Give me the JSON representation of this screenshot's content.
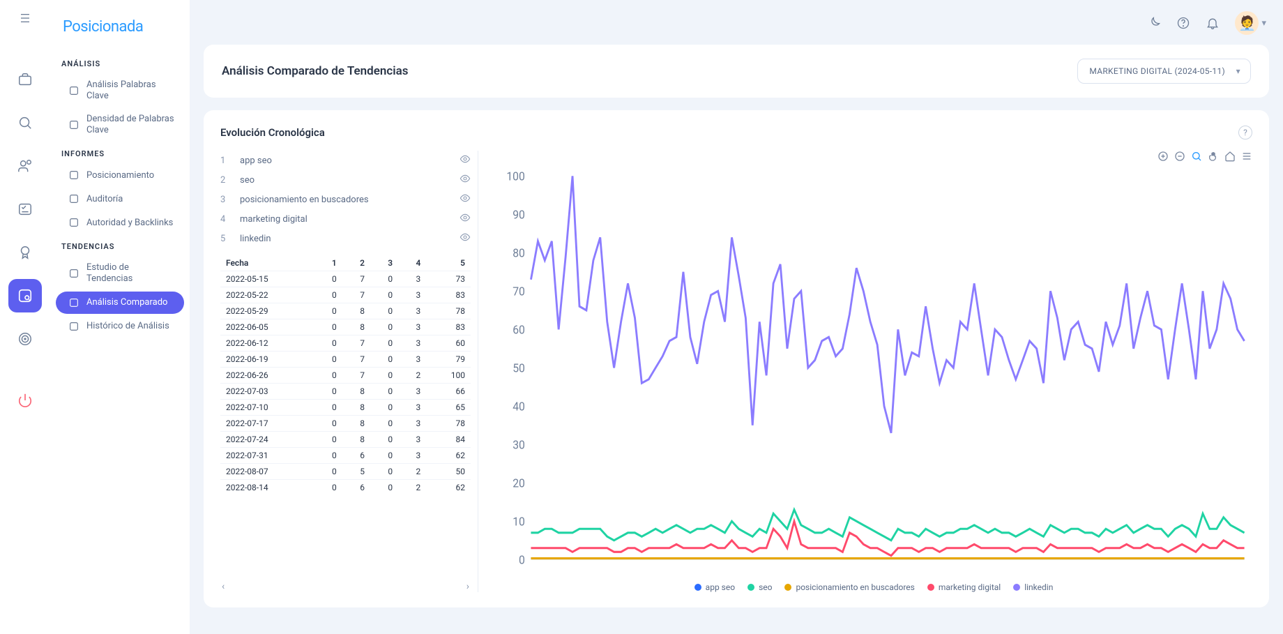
{
  "brand": "Posicionada",
  "sidebar": {
    "sections": [
      {
        "label": "ANÁLISIS",
        "items": [
          {
            "label": "Análisis Palabras Clave",
            "active": false
          },
          {
            "label": "Densidad de Palabras Clave",
            "active": false
          }
        ]
      },
      {
        "label": "INFORMES",
        "items": [
          {
            "label": "Posicionamiento",
            "active": false
          },
          {
            "label": "Auditoría",
            "active": false
          },
          {
            "label": "Autoridad y Backlinks",
            "active": false
          }
        ]
      },
      {
        "label": "TENDENCIAS",
        "items": [
          {
            "label": "Estudio de Tendencias",
            "active": false
          },
          {
            "label": "Análisis Comparado",
            "active": true
          },
          {
            "label": "Histórico de Análisis",
            "active": false
          }
        ]
      }
    ]
  },
  "header": {
    "title": "Análisis Comparado de Tendencias",
    "selected_project": "MARKETING DIGITAL (2024-05-11)"
  },
  "panel_title": "Evolución Cronológica",
  "keywords": [
    {
      "idx": 1,
      "name": "app seo"
    },
    {
      "idx": 2,
      "name": "seo"
    },
    {
      "idx": 3,
      "name": "posicionamiento en buscadores"
    },
    {
      "idx": 4,
      "name": "marketing digital"
    },
    {
      "idx": 5,
      "name": "linkedin"
    }
  ],
  "table": {
    "date_header": "Fecha",
    "col_headers": [
      "1",
      "2",
      "3",
      "4",
      "5"
    ],
    "rows": [
      {
        "date": "2022-05-15",
        "v": [
          0,
          7,
          0,
          3,
          73
        ]
      },
      {
        "date": "2022-05-22",
        "v": [
          0,
          7,
          0,
          3,
          83
        ]
      },
      {
        "date": "2022-05-29",
        "v": [
          0,
          8,
          0,
          3,
          78
        ]
      },
      {
        "date": "2022-06-05",
        "v": [
          0,
          8,
          0,
          3,
          83
        ]
      },
      {
        "date": "2022-06-12",
        "v": [
          0,
          7,
          0,
          3,
          60
        ]
      },
      {
        "date": "2022-06-19",
        "v": [
          0,
          7,
          0,
          3,
          79
        ]
      },
      {
        "date": "2022-06-26",
        "v": [
          0,
          7,
          0,
          2,
          100
        ]
      },
      {
        "date": "2022-07-03",
        "v": [
          0,
          8,
          0,
          3,
          66
        ]
      },
      {
        "date": "2022-07-10",
        "v": [
          0,
          8,
          0,
          3,
          65
        ]
      },
      {
        "date": "2022-07-17",
        "v": [
          0,
          8,
          0,
          3,
          78
        ]
      },
      {
        "date": "2022-07-24",
        "v": [
          0,
          8,
          0,
          3,
          84
        ]
      },
      {
        "date": "2022-07-31",
        "v": [
          0,
          6,
          0,
          3,
          62
        ]
      },
      {
        "date": "2022-08-07",
        "v": [
          0,
          5,
          0,
          2,
          50
        ]
      },
      {
        "date": "2022-08-14",
        "v": [
          0,
          6,
          0,
          2,
          62
        ]
      }
    ]
  },
  "chart_data": {
    "type": "line",
    "ylim": [
      0,
      100
    ],
    "yticks": [
      0,
      10,
      20,
      30,
      40,
      50,
      60,
      70,
      80,
      90,
      100
    ],
    "x_count": 104,
    "series": [
      {
        "name": "app seo",
        "color": "#2b6cff",
        "values": "zeros"
      },
      {
        "name": "seo",
        "color": "#1fd3a3",
        "values": "green"
      },
      {
        "name": "posicionamiento en buscadores",
        "color": "#e6a600",
        "values": "zeros"
      },
      {
        "name": "marketing digital",
        "color": "#ff4a6b",
        "values": "red"
      },
      {
        "name": "linkedin",
        "color": "#8b7cff",
        "values": "purple"
      }
    ],
    "purple": [
      73,
      83,
      78,
      83,
      60,
      79,
      100,
      66,
      65,
      78,
      84,
      62,
      50,
      62,
      72,
      63,
      46,
      47,
      50,
      53,
      57,
      58,
      75,
      58,
      51,
      62,
      69,
      70,
      62,
      84,
      74,
      63,
      35,
      62,
      48,
      72,
      77,
      55,
      68,
      70,
      50,
      52,
      57,
      58,
      53,
      55,
      64,
      76,
      70,
      62,
      56,
      40,
      33,
      60,
      48,
      54,
      53,
      66,
      55,
      46,
      52,
      50,
      62,
      60,
      72,
      60,
      48,
      60,
      58,
      52,
      47,
      52,
      57,
      55,
      46,
      70,
      63,
      52,
      60,
      62,
      56,
      55,
      49,
      62,
      56,
      61,
      72,
      55,
      63,
      70,
      61,
      60,
      47,
      60,
      72,
      60,
      47,
      70,
      55,
      60,
      72,
      68,
      60,
      57
    ],
    "green": [
      7,
      7,
      8,
      8,
      7,
      7,
      7,
      8,
      8,
      8,
      8,
      6,
      5,
      6,
      7,
      7,
      6,
      7,
      8,
      7,
      8,
      9,
      8,
      7,
      8,
      8,
      9,
      8,
      7,
      10,
      8,
      7,
      6,
      8,
      7,
      12,
      10,
      8,
      13,
      9,
      8,
      7,
      7,
      8,
      7,
      6,
      11,
      10,
      9,
      8,
      7,
      6,
      5,
      8,
      7,
      7,
      6,
      8,
      7,
      6,
      7,
      7,
      8,
      8,
      9,
      8,
      7,
      8,
      7,
      7,
      6,
      7,
      8,
      7,
      6,
      9,
      8,
      7,
      8,
      8,
      7,
      7,
      6,
      8,
      7,
      8,
      9,
      7,
      8,
      9,
      8,
      8,
      6,
      8,
      9,
      8,
      6,
      12,
      8,
      8,
      11,
      9,
      8,
      7
    ],
    "red": [
      3,
      3,
      3,
      3,
      3,
      3,
      2,
      3,
      3,
      3,
      3,
      3,
      2,
      2,
      3,
      3,
      2,
      3,
      3,
      3,
      3,
      4,
      3,
      3,
      3,
      3,
      4,
      3,
      3,
      5,
      3,
      3,
      2,
      3,
      3,
      8,
      6,
      3,
      10,
      4,
      3,
      3,
      3,
      3,
      3,
      2,
      7,
      6,
      4,
      3,
      3,
      2,
      1,
      3,
      3,
      3,
      2,
      3,
      3,
      2,
      3,
      3,
      3,
      3,
      4,
      3,
      3,
      3,
      3,
      3,
      2,
      3,
      3,
      3,
      2,
      4,
      3,
      3,
      3,
      3,
      3,
      3,
      2,
      3,
      3,
      3,
      4,
      3,
      3,
      4,
      3,
      3,
      2,
      3,
      4,
      3,
      2,
      4,
      3,
      3,
      5,
      4,
      3,
      3
    ]
  },
  "legend_labels": [
    "app seo",
    "seo",
    "posicionamiento en buscadores",
    "marketing digital",
    "linkedin"
  ],
  "legend_colors": [
    "#2b6cff",
    "#1fd3a3",
    "#e6a600",
    "#ff4a6b",
    "#8b7cff"
  ]
}
